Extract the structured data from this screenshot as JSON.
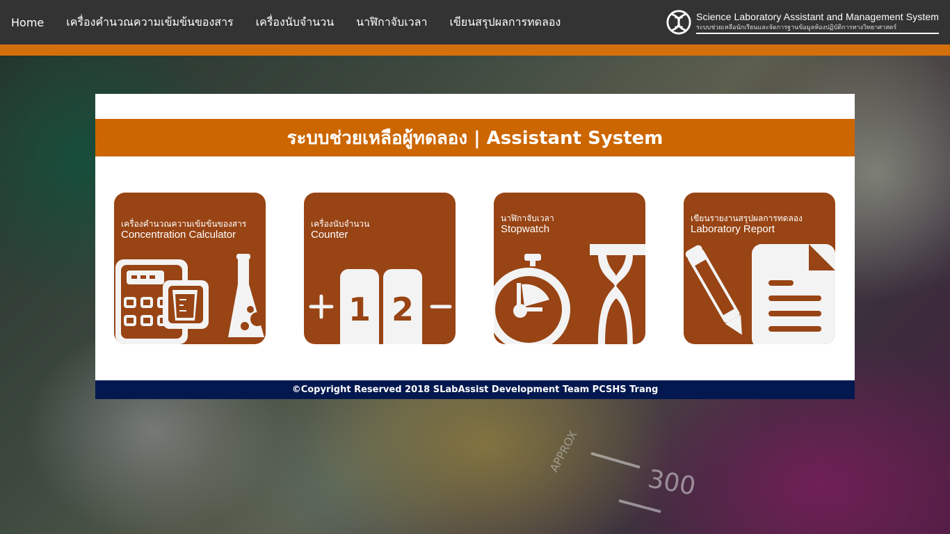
{
  "nav": {
    "items": [
      {
        "label": "Home"
      },
      {
        "label": "เครื่องคำนวณความเข้มข้นของสาร"
      },
      {
        "label": "เครื่องนับจำนวน"
      },
      {
        "label": "นาฬิกาจับเวลา"
      },
      {
        "label": "เขียนสรุปผลการทดลอง"
      }
    ]
  },
  "brand": {
    "title": "Science Laboratory Assistant and Management System",
    "subtitle": "ระบบช่วยเหลือนักเรียนและจัดการฐานข้อมูลห้องปฏิบัติการทางวิทยาศาสตร์"
  },
  "panel": {
    "title": "ระบบช่วยเหลือผู้ทดลอง | Assistant System"
  },
  "cards": [
    {
      "th": "เครื่องคำนวณความเข้มข้นของสาร",
      "en": "Concentration Calculator"
    },
    {
      "th": "เครื่องนับจำนวน",
      "en": "Counter",
      "digit1": "1",
      "digit2": "2"
    },
    {
      "th": "นาฬิกาจับเวลา",
      "en": "Stopwatch"
    },
    {
      "th": "เขียนรายงานสรุปผลการทดลอง",
      "en": "Laboratory Report"
    }
  ],
  "background": {
    "scale_label": "300",
    "scale_word": "APPROX"
  },
  "footer": {
    "text": "©Copyright Reserved 2018 SLabAssist Development Team PCSHS Trang"
  },
  "colors": {
    "topbar": "#333333",
    "accent_orange": "#cc6600",
    "card_brown": "#984414",
    "footer_navy": "#041850"
  }
}
